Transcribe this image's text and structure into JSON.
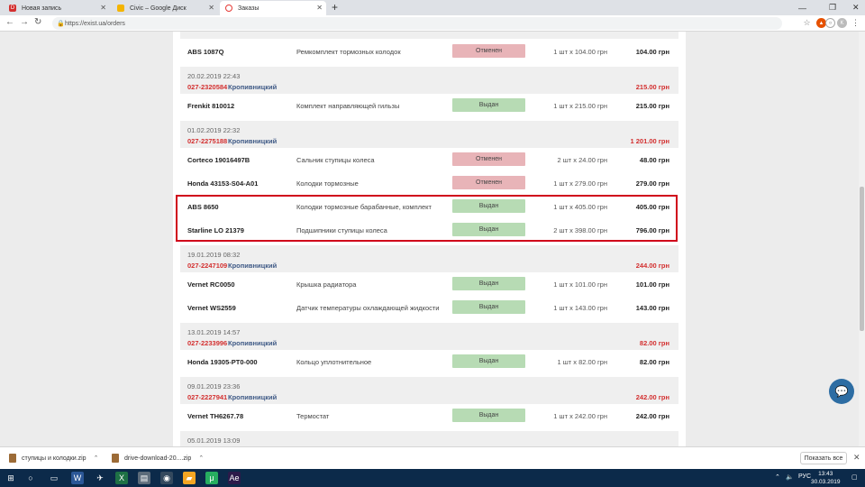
{
  "browser": {
    "tabs": [
      {
        "label": "Новая запись",
        "favicon_color": "#d32f2f",
        "favicon_letter": "D"
      },
      {
        "label": "Civic – Google Диск",
        "favicon_color": "#f4b400",
        "favicon_letter": ""
      },
      {
        "label": "Заказы",
        "favicon_color": "#e53935",
        "favicon_letter": ""
      }
    ],
    "url": "https://exist.ua/orders"
  },
  "order_groups": [
    {
      "partial": true,
      "items": [
        {
          "code": "ABS 1087Q",
          "name": "Ремкомплект тормозных колодок",
          "status": "Отменен",
          "status_type": "cancel",
          "qty": "1 шт х 104.00 грн",
          "sum": "104.00 грн"
        }
      ]
    },
    {
      "date": "20.02.2019 22:43",
      "number": "027-2320584",
      "city": "Кропивницкий",
      "total": "215.00 грн",
      "items": [
        {
          "code": "Frenkit 810012",
          "name": "Комплект направляющей гильзы",
          "status": "Выдан",
          "status_type": "issued",
          "qty": "1 шт х 215.00 грн",
          "sum": "215.00 грн"
        }
      ]
    },
    {
      "date": "01.02.2019 22:32",
      "number": "027-2275188",
      "city": "Кропивницкий",
      "total": "1 201.00 грн",
      "items": [
        {
          "code": "Corteco 19016497B",
          "name": "Сальник ступицы колеса",
          "status": "Отменен",
          "status_type": "cancel",
          "qty": "2 шт х 24.00 грн",
          "sum": "48.00 грн"
        },
        {
          "code": "Honda 43153-S04-A01",
          "name": "Колодки тормозные",
          "status": "Отменен",
          "status_type": "cancel",
          "qty": "1 шт х 279.00 грн",
          "sum": "279.00 грн"
        },
        {
          "code": "ABS 8650",
          "name": "Колодки тормозные барабанные, комплект",
          "status": "Выдан",
          "status_type": "issued",
          "qty": "1 шт х 405.00 грн",
          "sum": "405.00 грн"
        },
        {
          "code": "Starline LO 21379",
          "name": "Подшипники ступицы колеса",
          "status": "Выдан",
          "status_type": "issued",
          "qty": "2 шт х 398.00 грн",
          "sum": "796.00 грн"
        }
      ]
    },
    {
      "date": "19.01.2019 08:32",
      "number": "027-2247109",
      "city": "Кропивницкий",
      "total": "244.00 грн",
      "items": [
        {
          "code": "Vernet RC0050",
          "name": "Крышка радиатора",
          "status": "Выдан",
          "status_type": "issued",
          "qty": "1 шт х 101.00 грн",
          "sum": "101.00 грн"
        },
        {
          "code": "Vernet WS2559",
          "name": "Датчик температуры охлаждающей жидкости",
          "status": "Выдан",
          "status_type": "issued",
          "qty": "1 шт х 143.00 грн",
          "sum": "143.00 грн"
        }
      ]
    },
    {
      "date": "13.01.2019 14:57",
      "number": "027-2233996",
      "city": "Кропивницкий",
      "total": "82.00 грн",
      "items": [
        {
          "code": "Honda 19305-PT0-000",
          "name": "Кольцо уплотнительное",
          "status": "Выдан",
          "status_type": "issued",
          "qty": "1 шт х 82.00 грн",
          "sum": "82.00 грн"
        }
      ]
    },
    {
      "date": "09.01.2019 23:36",
      "number": "027-2227941",
      "city": "Кропивницкий",
      "total": "242.00 грн",
      "items": [
        {
          "code": "Vernet TH6267.78",
          "name": "Термостат",
          "status": "Выдан",
          "status_type": "issued",
          "qty": "1 шт х 242.00 грн",
          "sum": "242.00 грн"
        }
      ]
    },
    {
      "date": "05.01.2019 13:09",
      "partial": true,
      "items": []
    }
  ],
  "downloads": [
    {
      "name": "ступицы и колодки.zip"
    },
    {
      "name": "drive-download-20....zip"
    }
  ],
  "downloads_show_all": "Показать все",
  "taskbar": {
    "lang": "РУС",
    "time": "13:43",
    "date": "30.03.2019"
  },
  "colors": {
    "accent_red": "#d32f2f",
    "city_blue": "#3f5a86",
    "cancel_bg": "#e8b4b8",
    "issued_bg": "#b7dbb4",
    "highlight_border": "#d0021b"
  }
}
